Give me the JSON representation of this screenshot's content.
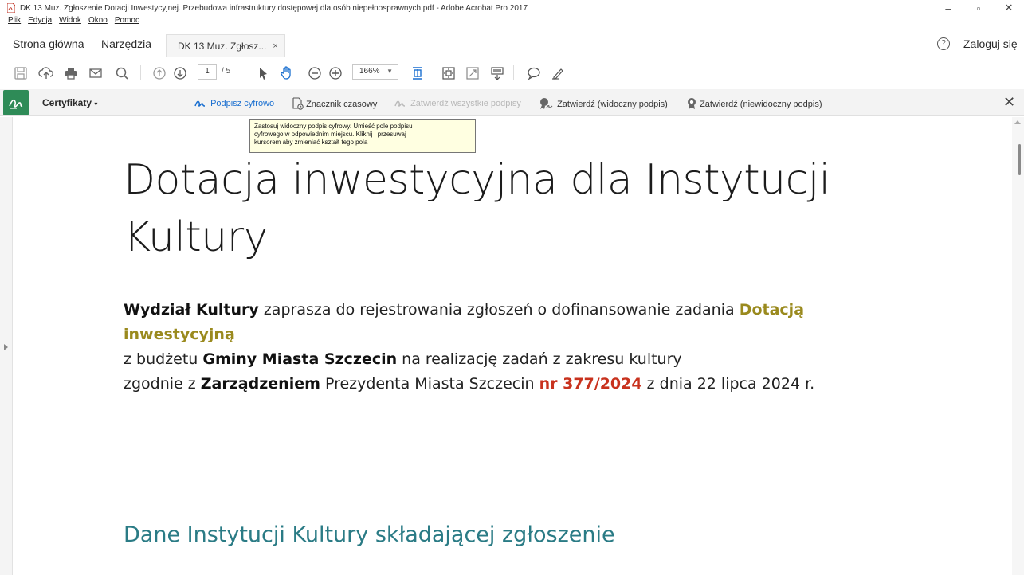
{
  "window": {
    "title": "DK 13 Muz. Zgłoszenie Dotacji Inwestycyjnej. Przebudowa infrastruktury dostępowej dla osób niepełnosprawnych.pdf - Adobe Acrobat Pro 2017",
    "minimize": "–",
    "restore": "▫",
    "close": "✕"
  },
  "menu": [
    "Plik",
    "Edycja",
    "Widok",
    "Okno",
    "Pomoc"
  ],
  "tabs": {
    "home": "Strona główna",
    "tools": "Narzędzia",
    "document": "DK 13 Muz. Zgłosz...",
    "document_close": "×",
    "help": "?",
    "login": "Zaloguj się"
  },
  "toolbar": {
    "current_page": "1",
    "total_pages": "/ 5",
    "zoom": "166%"
  },
  "certificates": {
    "title": "Certyfikaty",
    "dropdown_arrow": "▾",
    "items": [
      {
        "label": "Podpisz cyfrowo",
        "state": "active"
      },
      {
        "label": "Znacznik czasowy",
        "state": "normal"
      },
      {
        "label": "Zatwierdź wszystkie podpisy",
        "state": "disabled"
      },
      {
        "label": "Zatwierdź (widoczny podpis)",
        "state": "normal"
      },
      {
        "label": "Zatwierdź (niewidoczny podpis)",
        "state": "normal"
      }
    ],
    "close": "✕"
  },
  "tooltip": {
    "line1": "Zastosuj widoczny podpis cyfrowy. Umieść pole podpisu",
    "line2": "cyfrowego w odpowiednim miejscu. Kliknij i przesuwaj",
    "line3": "kursorem aby zmieniać kształt tego pola"
  },
  "document": {
    "title": "Dotacja inwestycyjna dla Instytucji Kultury",
    "para": {
      "dept": "Wydział Kultury",
      "text1": " zaprasza do rejestrowania zgłoszeń o dofinansowanie zadania ",
      "highlight1": "Dotacją inwestycyjną",
      "text2": "z budżetu ",
      "city": "Gminy Miasta Szczecin",
      "text3": " na realizację zadań z zakresu kultury",
      "text4": "zgodnie z ",
      "regulation": "Zarządzeniem",
      "text5": " Prezydenta Miasta Szczecin ",
      "number": "nr 377/2024",
      "text6": " z dnia 22 lipca 2024 r."
    },
    "section_heading": "Dane Instytucji Kultury składającej zgłoszenie"
  },
  "colors": {
    "accent_blue": "#1a6fd0",
    "cert_green": "#2e8b57",
    "olive": "#9a8a1e",
    "red": "#c8321e",
    "teal": "#2a7b85"
  }
}
